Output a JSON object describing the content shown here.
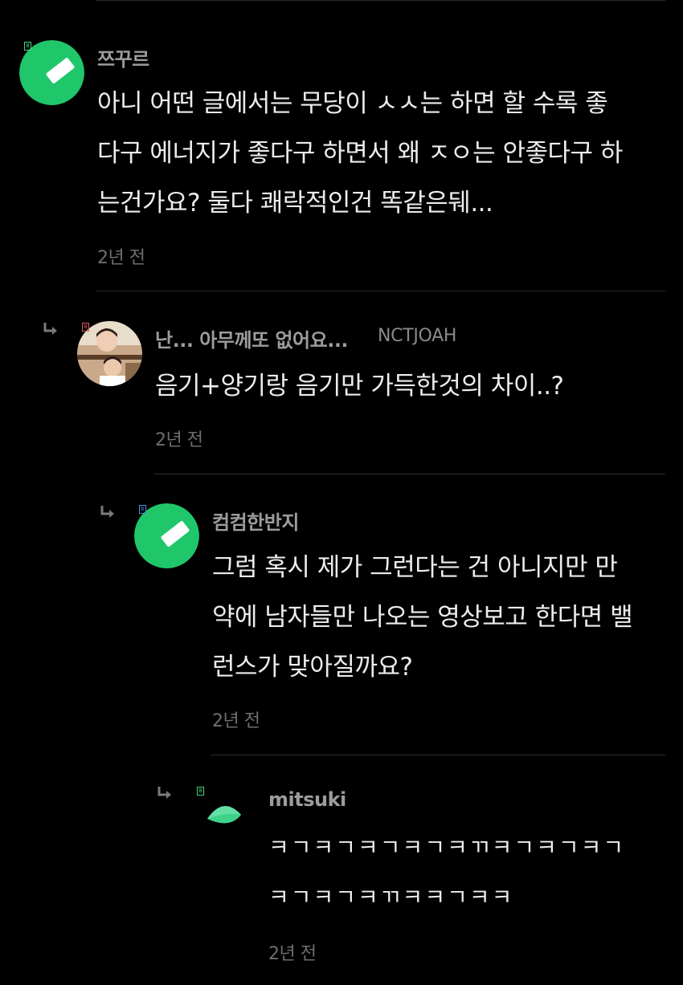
{
  "comments": [
    {
      "author": "쯔꾸르",
      "lines": [
        "아니 어떤 글에서는 무당이 ㅅㅅ는 하면 할 수록 좋",
        "다구 에너지가 좋다구 하면서 왜 ㅈㅇ는 안좋다구 하",
        "는건가요? 둘다 쾌락적인건 똑같은뒈..."
      ],
      "time": "2년 전",
      "badge": "8",
      "avatar_icon": "green-slash-avatar-icon"
    },
    {
      "author": "난... 아무께또 없어요...",
      "author_sub": "NCTJOAH",
      "lines": [
        "음기+양기랑 음기만 가득한것의 차이..?"
      ],
      "time": "2년 전",
      "badge": "8",
      "avatar_icon": "photo-avatar-icon"
    },
    {
      "author": "컴컴한반지",
      "lines": [
        "그럼 혹시 제가 그런다는 건 아니지만 만",
        "약에 남자들만 나오는 영상보고 한다면 밸",
        "런스가 맞아질까요?"
      ],
      "time": "2년 전",
      "badge": "b",
      "avatar_icon": "green-slash-avatar-icon"
    },
    {
      "author": "mitsuki",
      "lines": [
        "ㅋㄱㅋㄱㅋㄱㅋㄱㅋㄲㅋㄱㅋㄱㅋㄱ",
        "ㅋㄱㅋㄱㅋㄲㅋㅋㄱㅋㅋ"
      ],
      "time": "2년 전",
      "badge": "8",
      "avatar_icon": "leaf-avatar-icon"
    }
  ],
  "colors": {
    "background": "#000000",
    "avatar_green": "#1fc76a",
    "badge_green": "#3fd17a",
    "badge_red": "#e05a5a",
    "badge_blue": "#4a8fe0"
  }
}
